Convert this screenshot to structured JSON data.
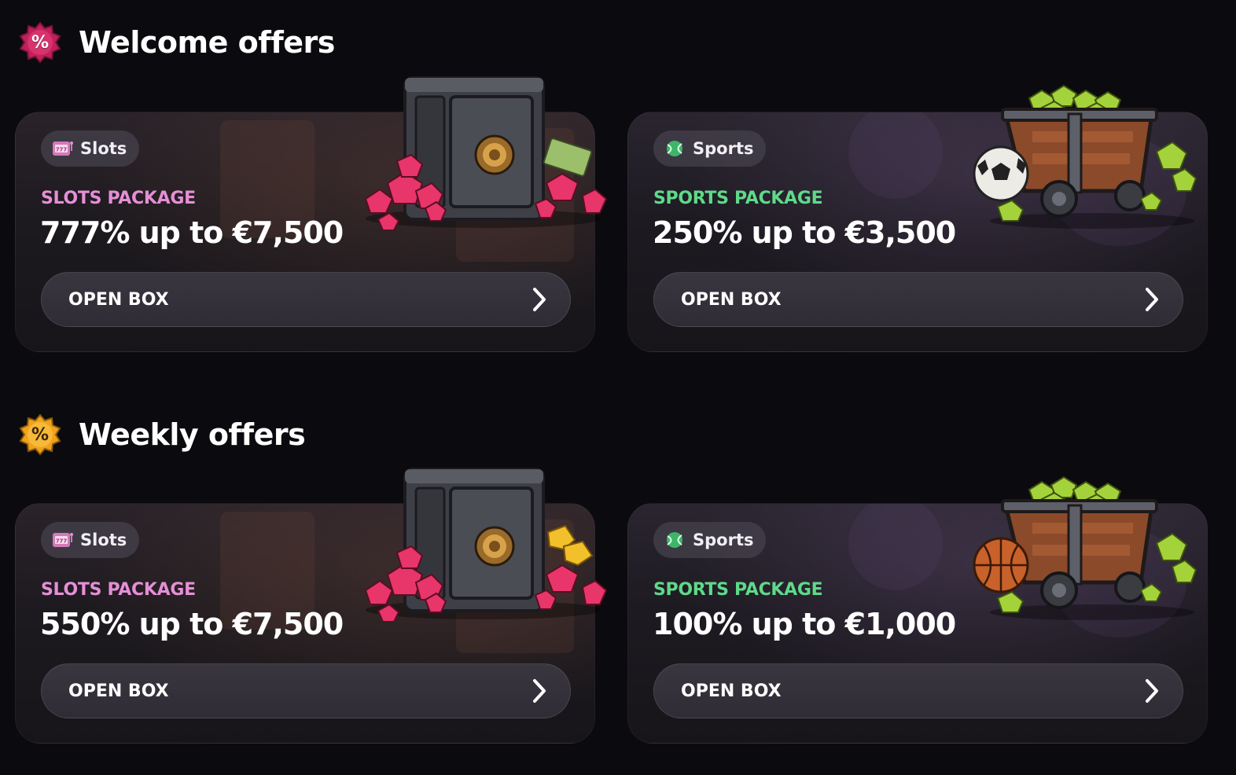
{
  "sections": [
    {
      "title": "Welcome offers",
      "badge_symbol": "%",
      "badge_color": "#c0215a",
      "cards": [
        {
          "category": "Slots",
          "category_icon": "slot-machine-icon",
          "package_label": "SLOTS PACKAGE",
          "amount": "777% up to €7,500",
          "button_label": "OPEN BOX",
          "art": "safe-with-gems"
        },
        {
          "category": "Sports",
          "category_icon": "tennis-ball-icon",
          "package_label": "SPORTS PACKAGE",
          "amount": "250% up to €3,500",
          "button_label": "OPEN BOX",
          "art": "mine-cart-with-soccer-ball"
        }
      ]
    },
    {
      "title": "Weekly offers",
      "badge_symbol": "%",
      "badge_color": "#f0a21c",
      "cards": [
        {
          "category": "Slots",
          "category_icon": "slot-machine-icon",
          "package_label": "SLOTS PACKAGE",
          "amount": "550% up to €7,500",
          "button_label": "OPEN BOX",
          "art": "safe-with-gems-and-gold"
        },
        {
          "category": "Sports",
          "category_icon": "tennis-ball-icon",
          "package_label": "SPORTS PACKAGE",
          "amount": "100% up to €1,000",
          "button_label": "OPEN BOX",
          "art": "mine-cart-with-basketball"
        }
      ]
    }
  ],
  "colors": {
    "slots_accent": "#e58fd6",
    "sports_accent": "#5fd98a",
    "background": "#0b0a0e"
  }
}
